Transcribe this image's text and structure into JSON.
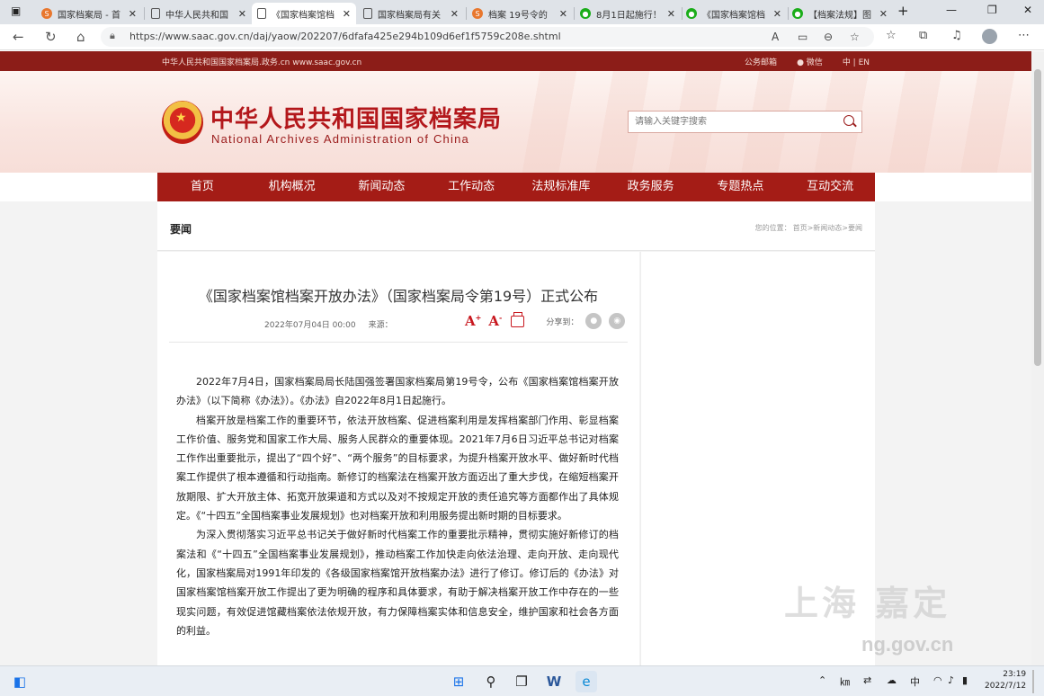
{
  "browser": {
    "tabs": [
      {
        "label": "国家档案局 - 首",
        "icon": "sa"
      },
      {
        "label": "中华人民共和国",
        "icon": "doc"
      },
      {
        "label": "《国家档案馆档",
        "icon": "doc",
        "active": true
      },
      {
        "label": "国家档案局有关",
        "icon": "doc"
      },
      {
        "label": "档案 19号令的",
        "icon": "sa"
      },
      {
        "label": "8月1日起施行！",
        "icon": "wx"
      },
      {
        "label": "《国家档案馆档",
        "icon": "wx"
      },
      {
        "label": "【档案法规】图",
        "icon": "wx"
      }
    ],
    "new_tab": "+",
    "url": "https://www.saac.gov.cn/daj/yaow/202207/6dfafa425e294b109d6ef1f5759c208e.shtml"
  },
  "site": {
    "domain_text": "中华人民共和国国家档案局.政务.cn www.saac.gov.cn",
    "top_links": [
      "公务邮箱",
      "微信",
      "中 | EN"
    ],
    "cn_name": "中华人民共和国国家档案局",
    "en_name": "National Archives Administration of China",
    "search_placeholder": "请输入关键字搜索",
    "nav": [
      "首页",
      "机构概况",
      "新闻动态",
      "工作动态",
      "法规标准库",
      "政务服务",
      "专题热点",
      "互动交流"
    ]
  },
  "section": {
    "title": "要闻",
    "crumb_prefix": "您的位置：",
    "crumb_path": "首页>新闻动态>要闻"
  },
  "article": {
    "title": "《国家档案馆档案开放办法》（国家档案局令第19号）正式公布",
    "date": "2022年07月04日 00:00",
    "source": "来源：",
    "share_label": "分享到：",
    "paragraphs": [
      "2022年7月4日，国家档案局局长陆国强签署国家档案局第19号令，公布《国家档案馆档案开放办法》（以下简称《办法》）。《办法》自2022年8月1日起施行。",
      "档案开放是档案工作的重要环节，依法开放档案、促进档案利用是发挥档案部门作用、彰显档案工作价值、服务党和国家工作大局、服务人民群众的重要体现。2021年7月6日习近平总书记对档案工作作出重要批示，提出了“四个好”、“两个服务”的目标要求，为提升档案开放水平、做好新时代档案工作提供了根本遵循和行动指南。新修订的档案法在档案开放方面迈出了重大步伐，在缩短档案开放期限、扩大开放主体、拓宽开放渠道和方式以及对不按规定开放的责任追究等方面都作出了具体规定。《“十四五”全国档案事业发展规划》也对档案开放和利用服务提出新时期的目标要求。",
      "为深入贯彻落实习近平总书记关于做好新时代档案工作的重要批示精神，贯彻实施好新修订的档案法和《“十四五”全国档案事业发展规划》，推动档案工作加快走向依法治理、走向开放、走向现代化，国家档案局对1991年印发的《各级国家档案馆开放档案办法》进行了修订。修订后的《办法》对国家档案馆档案开放工作提出了更为明确的程序和具体要求，有助于解决档案开放工作中存在的一些现实问题，有效促进馆藏档案依法依规开放，有力保障档案实体和信息安全，维护国家和社会各方面的利益。"
    ]
  },
  "watermark": {
    "text": "上海 嘉定",
    "url_fragment": "ng.gov.cn"
  },
  "taskbar": {
    "tray_lang": "中",
    "time": "23:19",
    "date": "2022/7/12"
  },
  "colors": {
    "brand_red": "#a41c16",
    "top_strip": "#8c1d18",
    "title_red": "#b3171b"
  }
}
